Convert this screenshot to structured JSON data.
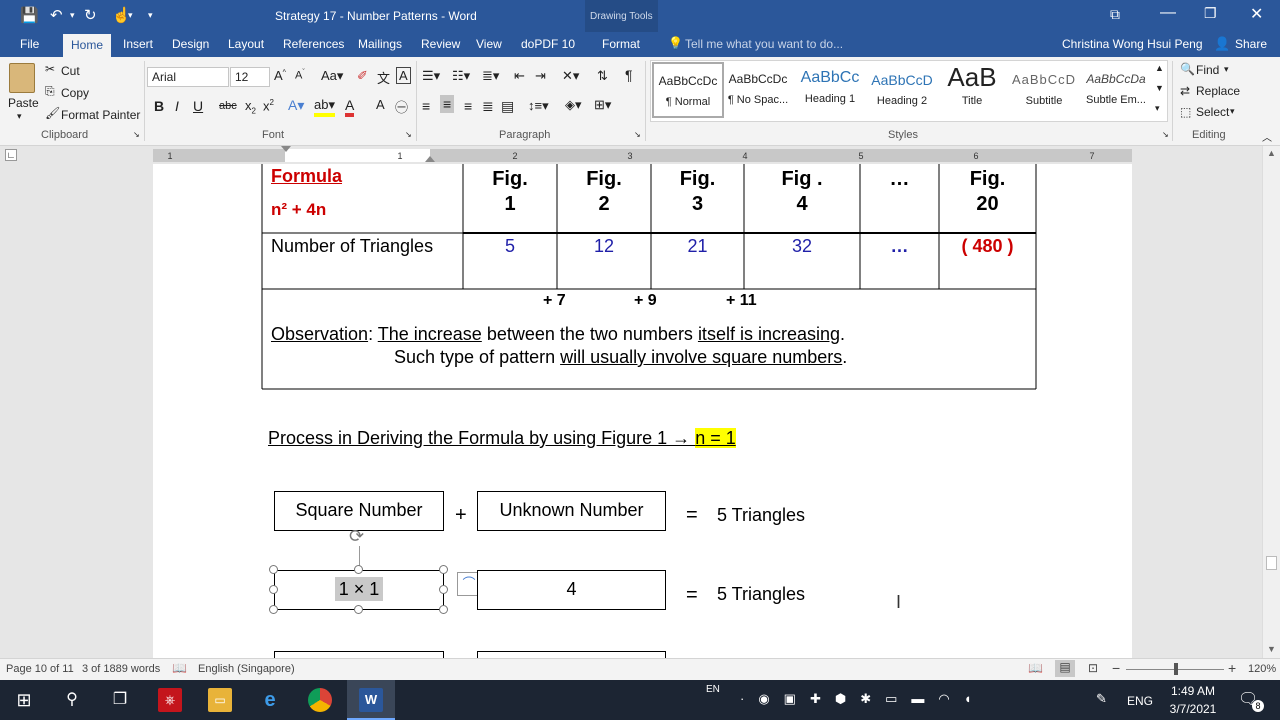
{
  "window": {
    "title": "Strategy 17 - Number Patterns - Word",
    "contextual_group": "Drawing Tools",
    "user": "Christina Wong Hsui Peng",
    "share": "Share"
  },
  "tabs": [
    "File",
    "Home",
    "Insert",
    "Design",
    "Layout",
    "References",
    "Mailings",
    "Review",
    "View",
    "doPDF 10",
    "Format"
  ],
  "tell_me": "Tell me what you want to do...",
  "ribbon": {
    "clipboard": {
      "paste": "Paste",
      "cut": "Cut",
      "copy": "Copy",
      "format_painter": "Format Painter",
      "label": "Clipboard"
    },
    "font": {
      "name": "Arial",
      "size": "12",
      "label": "Font"
    },
    "paragraph": {
      "label": "Paragraph"
    },
    "styles": {
      "label": "Styles",
      "items": [
        {
          "preview": "AaBbCcDc",
          "name": "¶ Normal"
        },
        {
          "preview": "AaBbCcDc",
          "name": "¶ No Spac..."
        },
        {
          "preview": "AaBbCc",
          "name": "Heading 1"
        },
        {
          "preview": "AaBbCcD",
          "name": "Heading 2"
        },
        {
          "preview": "AaB",
          "name": "Title"
        },
        {
          "preview": "AaBbCcD",
          "name": "Subtitle"
        },
        {
          "preview": "AaBbCcDa",
          "name": "Subtle Em..."
        }
      ]
    },
    "editing": {
      "find": "Find",
      "replace": "Replace",
      "select": "Select",
      "label": "Editing"
    }
  },
  "document": {
    "formula_label": "Formula",
    "formula": "n² + 4n",
    "figures": [
      {
        "l1": "Fig.",
        "l2": "1"
      },
      {
        "l1": "Fig.",
        "l2": "2"
      },
      {
        "l1": "Fig.",
        "l2": "3"
      },
      {
        "l1": "Fig .",
        "l2": "4"
      },
      {
        "l1": "…",
        "l2": ""
      },
      {
        "l1": "Fig.",
        "l2": "20"
      }
    ],
    "row_label": "Number of Triangles",
    "values": [
      "5",
      "12",
      "21",
      "32",
      "…",
      "( 480 )"
    ],
    "differences": [
      "+ 7",
      "+ 9",
      "+ 11"
    ],
    "observation_label": "Observation",
    "obs_line1_a": "The increase",
    "obs_line1_b": " between the two numbers ",
    "obs_line1_c": "itself is increasing",
    "obs_line1_d": ".",
    "obs_line2_a": "Such type of pattern ",
    "obs_line2_b": "will usually involve square numbers",
    "obs_line2_c": ".",
    "process_heading": "Process in Deriving the Formula by using Figure 1 → ",
    "process_highlight": "n = 1",
    "box_square": "Square Number",
    "plus": "+",
    "box_unknown": "Unknown Number",
    "equals": "=",
    "result1": "5 Triangles",
    "box_square_val": "1 × 1",
    "box_unknown_val": "4",
    "result2": "5 Triangles"
  },
  "status": {
    "page": "Page 10 of 11",
    "words": "3 of 1889 words",
    "language": "English (Singapore)",
    "zoom": "120%"
  },
  "taskbar": {
    "lang_indicator": "EN",
    "keyboard": "ENG",
    "time": "1:49 AM",
    "date": "3/7/2021",
    "notifications": "8"
  },
  "colors": {
    "word_blue": "#2b579a",
    "formula_red": "#cc0000",
    "value_blue": "#1f1fa8",
    "highlight": "#ffff00"
  }
}
